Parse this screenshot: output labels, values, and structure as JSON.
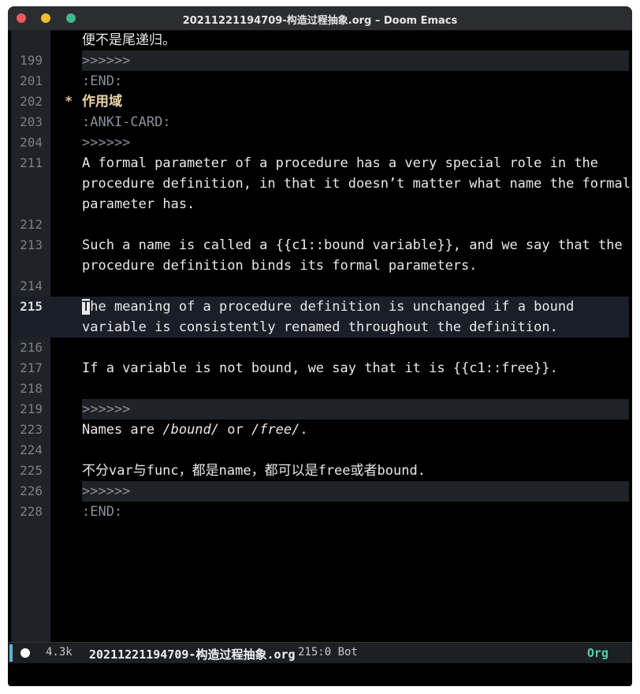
{
  "window": {
    "title": "20211221194709-构造过程抽象.org – Doom Emacs"
  },
  "editor": {
    "lines": [
      {
        "num": "",
        "text": "便不是尾递归。"
      },
      {
        "num": "199",
        "text": ">>>>>>"
      },
      {
        "num": "201",
        "text": ":END:"
      },
      {
        "num": "202",
        "star": "*",
        "text": "作用域"
      },
      {
        "num": "203",
        "text": ":ANKI-CARD:"
      },
      {
        "num": "204",
        "text": ">>>>>>"
      },
      {
        "num": "211",
        "text": "A formal parameter of a procedure has a very special role in the"
      },
      {
        "num": "",
        "text": "procedure definition, in that it doesn’t matter what name the formal"
      },
      {
        "num": "",
        "text": "parameter has."
      },
      {
        "num": "212",
        "text": ""
      },
      {
        "num": "213",
        "text": "Such a name is called a {{c1::bound variable}}, and we say that the"
      },
      {
        "num": "",
        "text": "procedure definition binds its formal parameters."
      },
      {
        "num": "214",
        "text": ""
      },
      {
        "num": "215",
        "cursor_char": "T",
        "text": "he meaning of a procedure definition is unchanged if a bound"
      },
      {
        "num": "",
        "text": "variable is consistently renamed throughout the definition."
      },
      {
        "num": "216",
        "text": ""
      },
      {
        "num": "217",
        "text": "If a variable is not bound, we say that it is {{c1::free}}."
      },
      {
        "num": "218",
        "text": ""
      },
      {
        "num": "219",
        "text": ">>>>>>"
      },
      {
        "num": "223",
        "text_a": "Names are ",
        "italic_a": "/bound/",
        "text_b": " or ",
        "italic_b": "/free/",
        "text_c": "."
      },
      {
        "num": "224",
        "text": ""
      },
      {
        "num": "225",
        "text": "不分var与func，都是name，都可以是free或者bound."
      },
      {
        "num": "226",
        "text": ">>>>>>"
      },
      {
        "num": "228",
        "text": ":END:"
      }
    ]
  },
  "modeline": {
    "size": "4.3k",
    "filename": "20211221194709-构造过程抽象.org",
    "position": "215:0 Bot",
    "major_mode": "Org"
  },
  "colors": {
    "background": "#000000",
    "accent": "#4fd1a5",
    "heading": "#f0d7a8"
  }
}
